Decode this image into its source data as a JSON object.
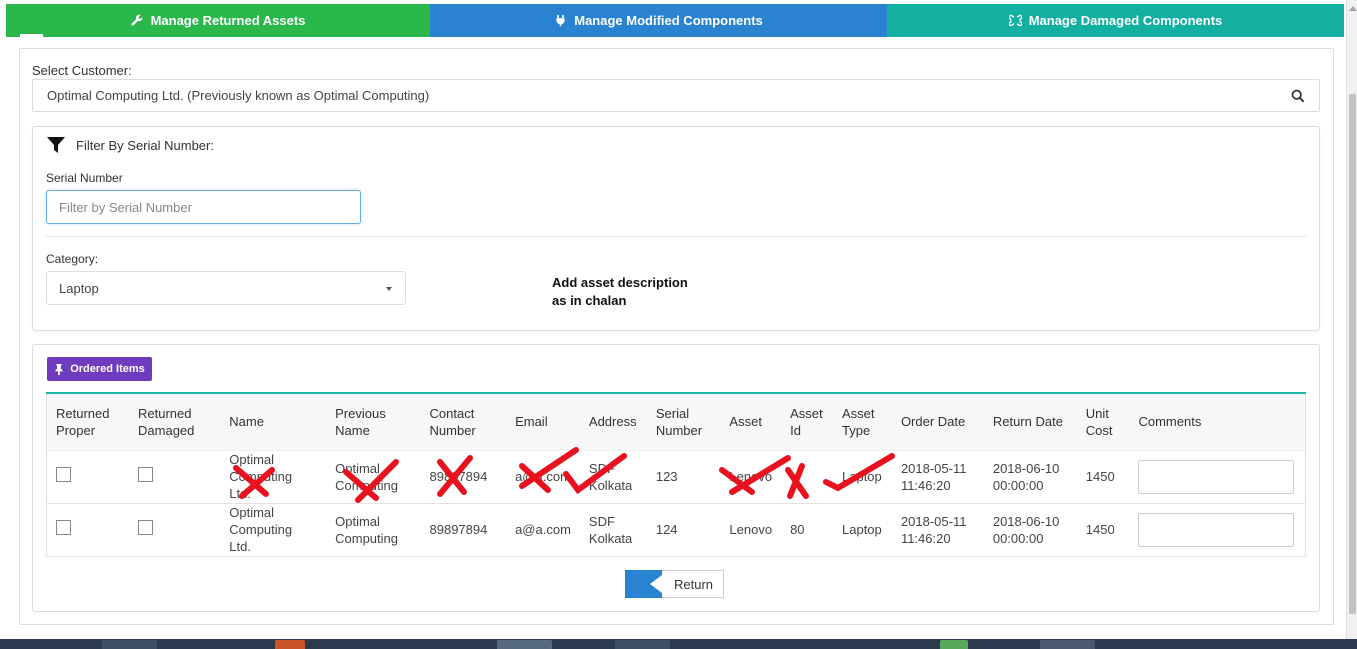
{
  "tabs": [
    {
      "label": "Manage Returned Assets",
      "icon": "wrench-icon"
    },
    {
      "label": "Manage Modified Components",
      "icon": "plug-icon"
    },
    {
      "label": "Manage Damaged Components",
      "icon": "unlink-icon"
    }
  ],
  "customer": {
    "label": "Select Customer:",
    "value": "Optimal Computing Ltd. (Previously known as Optimal Computing)"
  },
  "filter": {
    "title": "Filter By Serial Number:",
    "serial_label": "Serial Number",
    "serial_placeholder": "Filter by Serial Number",
    "category_label": "Category:",
    "category_value": "Laptop"
  },
  "annotation_note": {
    "line1": "Add asset description",
    "line2": "as in chalan"
  },
  "ordered_items": {
    "badge": "Ordered Items",
    "columns": [
      "Returned Proper",
      "Returned Damaged",
      "Name",
      "Previous Name",
      "Contact Number",
      "Email",
      "Address",
      "Serial Number",
      "Asset",
      "Asset Id",
      "Asset Type",
      "Order Date",
      "Return Date",
      "Unit Cost",
      "Comments"
    ],
    "rows": [
      {
        "name": "Optimal Computing Ltd.",
        "previous_name": "Optimal Computing",
        "contact": "89897894",
        "email": "a@a.com",
        "address": "SDF Kolkata",
        "serial": "123",
        "asset": "Lenovo",
        "asset_id": "",
        "asset_type": "Laptop",
        "order_date": "2018-05-11 11:46:20",
        "return_date": "2018-06-10 00:00:00",
        "unit_cost": "1450"
      },
      {
        "name": "Optimal Computing Ltd.",
        "previous_name": "Optimal Computing",
        "contact": "89897894",
        "email": "a@a.com",
        "address": "SDF Kolkata",
        "serial": "124",
        "asset": "Lenovo",
        "asset_id": "80",
        "asset_type": "Laptop",
        "order_date": "2018-05-11 11:46:20",
        "return_date": "2018-06-10 00:00:00",
        "unit_cost": "1450"
      }
    ]
  },
  "return_button": "Return",
  "colors": {
    "tab_green": "#2ab84a",
    "tab_blue": "#2a83d1",
    "tab_teal": "#13b0a2",
    "badge_purple": "#6f3cc0",
    "annotation_red": "#e8111d"
  }
}
